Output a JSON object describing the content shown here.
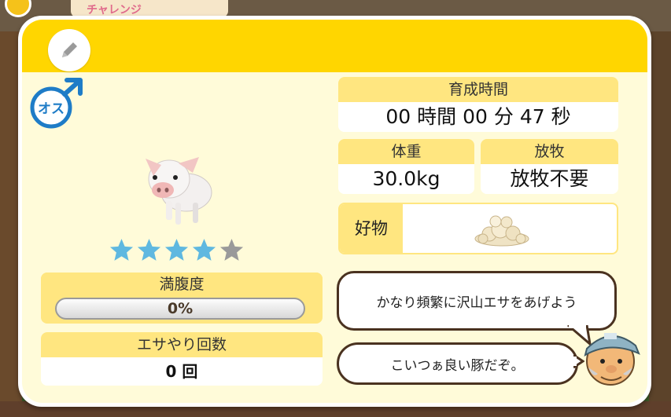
{
  "background": {
    "banner_text": "チャレンジ"
  },
  "header": {
    "edit_icon": "pencil-icon"
  },
  "pet": {
    "gender_label": "オス",
    "gender_icon": "male-symbol-icon",
    "stars_total": 5,
    "stars_filled": 4,
    "star_color": "#5fb8e0",
    "star_empty_color": "#9a9a9a"
  },
  "stats": {
    "satiety": {
      "label": "満腹度",
      "value": "0%",
      "fraction": 0
    },
    "feed_count": {
      "label": "エサやり回数",
      "value": "0 回"
    },
    "growth_time": {
      "label": "育成時間",
      "value": "00 時間 00 分 47 秒"
    },
    "weight": {
      "label": "体重",
      "value": "30.0kg"
    },
    "pasture": {
      "label": "放牧",
      "value": "放牧不要"
    },
    "favorite": {
      "label": "好物",
      "icon": "feed-pile-icon"
    }
  },
  "advice": {
    "tip": "かなり頻繁に沢山エサをあげよう",
    "comment": "こいつぁ良い豚だぞ。"
  },
  "colors": {
    "header_yellow": "#ffd600",
    "panel_bg": "#fffbd9",
    "label_bg": "#ffe680"
  }
}
